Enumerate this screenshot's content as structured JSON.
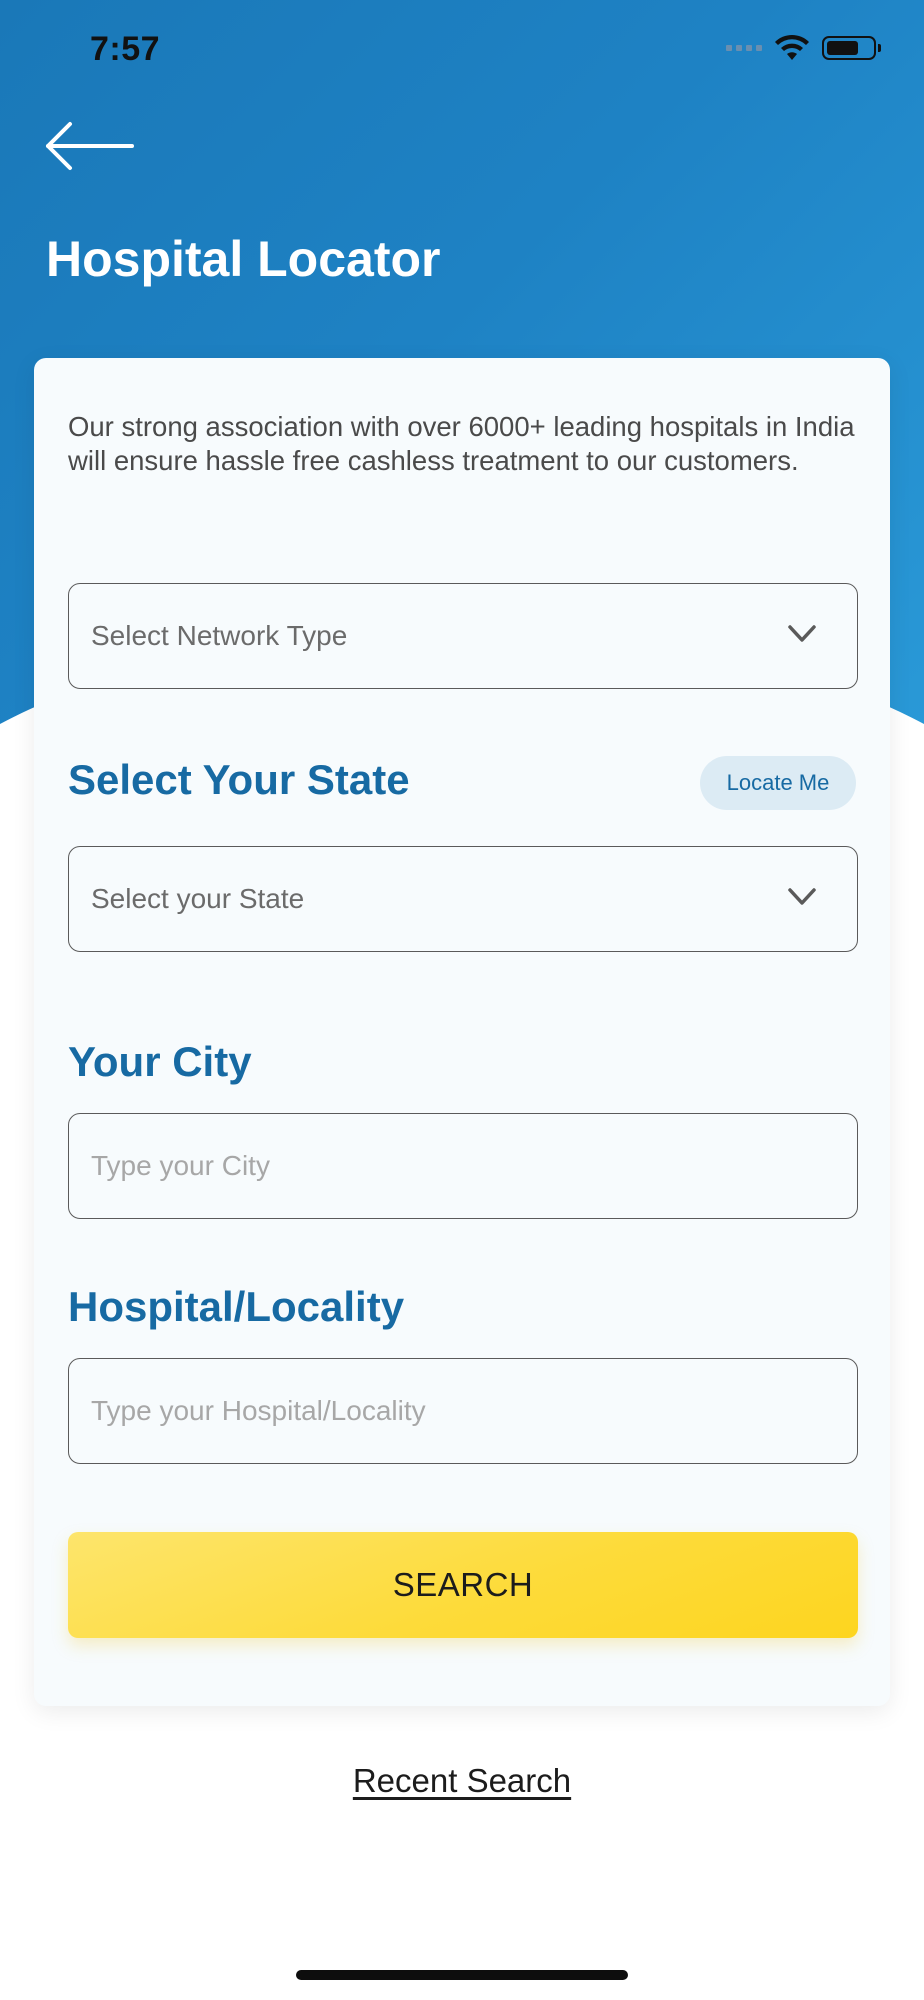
{
  "status_bar": {
    "time": "7:57"
  },
  "header": {
    "title": "Hospital Locator"
  },
  "card": {
    "intro": "Our strong association with over 6000+ leading hospitals in India will ensure hassle free cashless treatment to our customers.",
    "network_type": {
      "placeholder": "Select Network Type"
    },
    "state": {
      "label": "Select Your State",
      "locate_label": "Locate Me",
      "placeholder": "Select your State"
    },
    "city": {
      "label": "Your City",
      "placeholder": "Type your City"
    },
    "locality": {
      "label": "Hospital/Locality",
      "placeholder": "Type your Hospital/Locality"
    },
    "search_label": "SEARCH"
  },
  "recent_search_label": "Recent Search",
  "colors": {
    "primary_blue": "#176aa3",
    "header_gradient_start": "#1a78b8",
    "header_gradient_end": "#2a9ad8",
    "search_yellow": "#fddb3a"
  },
  "icons": {
    "back": "arrow-left-icon",
    "dropdown": "chevron-down-icon",
    "wifi": "wifi-icon",
    "battery": "battery-icon",
    "signal": "signal-icon"
  }
}
